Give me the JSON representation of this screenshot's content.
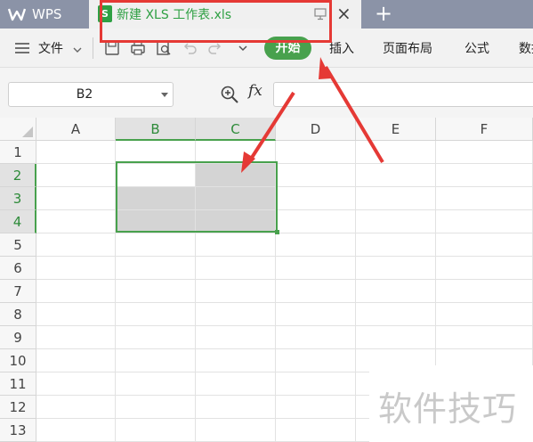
{
  "app": {
    "name": "WPS"
  },
  "document_tab": {
    "title": "新建 XLS 工作表.xls",
    "icon_letter": "S"
  },
  "menu": {
    "file_label": "文件",
    "start_label": "开始",
    "items": [
      "插入",
      "页面布局",
      "公式",
      "数据"
    ]
  },
  "formula_bar": {
    "name_box": "B2",
    "fx_label": "fx",
    "formula": ""
  },
  "sheet": {
    "columns": [
      "A",
      "B",
      "C",
      "D",
      "E",
      "F"
    ],
    "rows": [
      "1",
      "2",
      "3",
      "4",
      "5",
      "6",
      "7",
      "8",
      "9",
      "10",
      "11",
      "12",
      "13"
    ],
    "selected_range": "B2:C4",
    "selected_columns": [
      "B",
      "C"
    ],
    "selected_rows": [
      "2",
      "3",
      "4"
    ],
    "active_cell": "B2"
  },
  "watermark": {
    "text": "软件技巧"
  },
  "colors": {
    "accent_green": "#48a14d",
    "annotation_red": "#e53935",
    "tab_bar": "#8b93a7"
  }
}
